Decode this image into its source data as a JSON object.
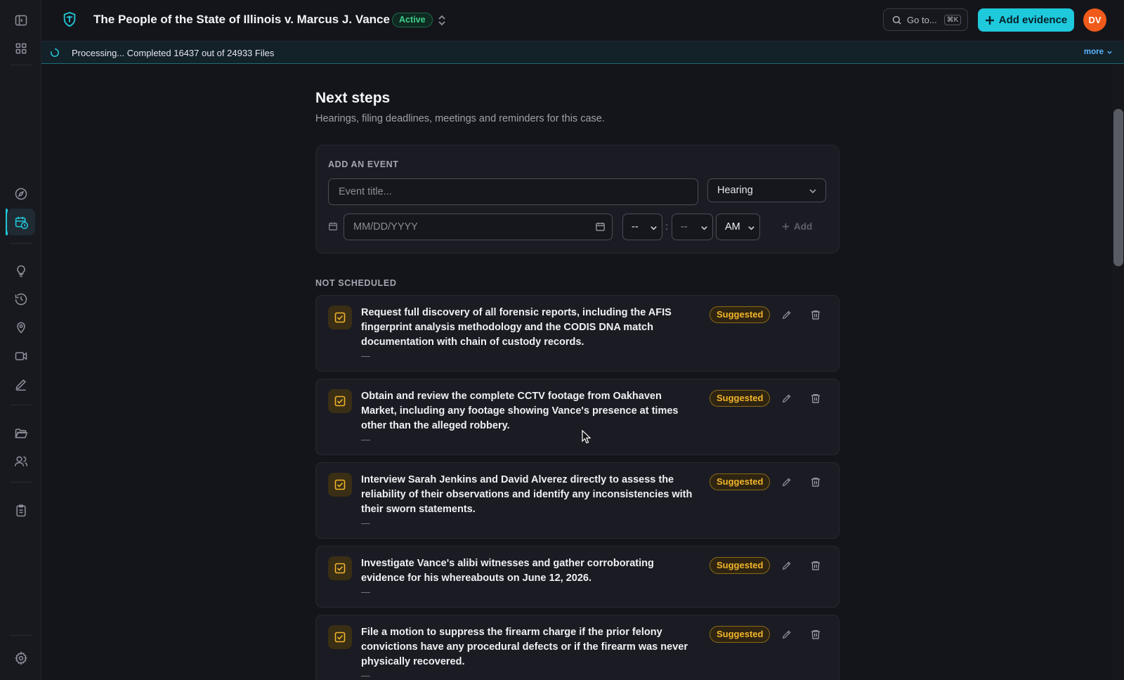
{
  "header": {
    "case_title": "The People of the State of Illinois v. Marcus J. Vance",
    "status": "Active",
    "goto_label": "Go to...",
    "goto_shortcut": "⌘K",
    "add_evidence_label": "Add evidence",
    "avatar_initials": "DV"
  },
  "processing": {
    "text": "Processing... Completed 16437 out of 24933 Files",
    "more_label": "more"
  },
  "page": {
    "title": "Next steps",
    "subtitle": "Hearings, filing deadlines, meetings and reminders for this case."
  },
  "add_event": {
    "section_label": "ADD AN EVENT",
    "title_placeholder": "Event title...",
    "type_value": "Hearing",
    "date_placeholder": "MM/DD/YYYY",
    "hour_value": "--",
    "minute_value": "--",
    "ampm_value": "AM",
    "add_label": "Add"
  },
  "not_scheduled": {
    "section_label": "NOT SCHEDULED",
    "items": [
      {
        "text": "Request full discovery of all forensic reports, including the AFIS fingerprint analysis methodology and the CODIS DNA match documentation with chain of custody records.",
        "date": "—",
        "badge": "Suggested"
      },
      {
        "text": "Obtain and review the complete CCTV footage from Oakhaven Market, including any footage showing Vance's presence at times other than the alleged robbery.",
        "date": "—",
        "badge": "Suggested"
      },
      {
        "text": "Interview Sarah Jenkins and David Alverez directly to assess the reliability of their observations and identify any inconsistencies with their sworn statements.",
        "date": "—",
        "badge": "Suggested"
      },
      {
        "text": "Investigate Vance's alibi witnesses and gather corroborating evidence for his whereabouts on June 12, 2026.",
        "date": "—",
        "badge": "Suggested"
      },
      {
        "text": "File a motion to suppress the firearm charge if the prior felony convictions have any procedural defects or if the firearm was never physically recovered.",
        "date": "—",
        "badge": "Suggested"
      }
    ]
  },
  "colors": {
    "accent": "#1ec9dc",
    "active_green": "#3ecf8e",
    "suggested_amber": "#f2b52b",
    "avatar_orange": "#f05a1a",
    "background": "#14151b"
  },
  "icons": {
    "sidebar": [
      "sidebar-toggle-icon",
      "grid-icon",
      "compass-icon",
      "calendar-clock-icon",
      "lightbulb-icon",
      "history-icon",
      "map-pin-icon",
      "video-icon",
      "pen-icon",
      "folder-open-icon",
      "users-icon",
      "clipboard-icon",
      "gear-icon"
    ]
  }
}
